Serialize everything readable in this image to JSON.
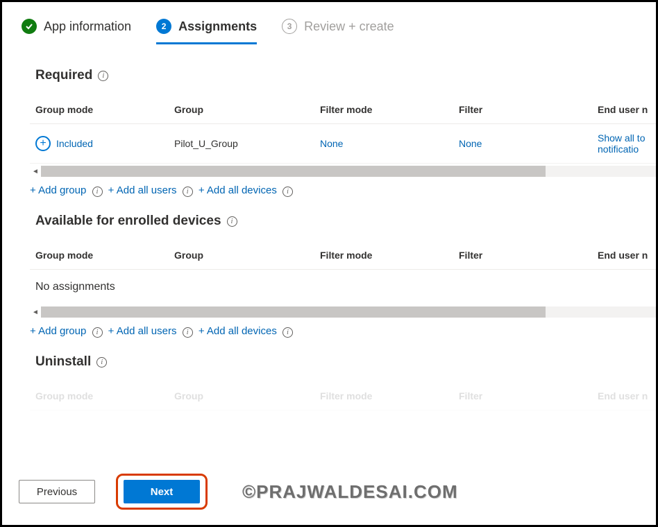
{
  "tabs": {
    "step1": {
      "num": "✓",
      "label": "App information"
    },
    "step2": {
      "num": "2",
      "label": "Assignments"
    },
    "step3": {
      "num": "3",
      "label": "Review + create"
    }
  },
  "columns": {
    "group_mode": "Group mode",
    "group": "Group",
    "filter_mode": "Filter mode",
    "filter": "Filter",
    "end_user": "End user n"
  },
  "required": {
    "title": "Required",
    "row": {
      "mode": "Included",
      "group": "Pilot_U_Group",
      "filter_mode": "None",
      "filter": "None",
      "end_user_line1": "Show all to",
      "end_user_line2": "notificatio"
    }
  },
  "available": {
    "title": "Available for enrolled devices",
    "empty": "No assignments"
  },
  "uninstall": {
    "title": "Uninstall"
  },
  "actions": {
    "add_group": "+ Add group",
    "add_all_users": "+ Add all users",
    "add_all_devices": "+ Add all devices"
  },
  "footer": {
    "previous": "Previous",
    "next": "Next"
  },
  "watermark": "©PRAJWALDESAI.COM"
}
